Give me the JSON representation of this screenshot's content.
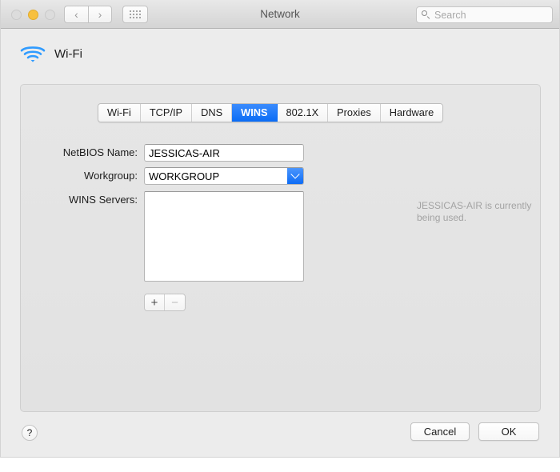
{
  "window": {
    "title": "Network",
    "traffic_lights": [
      {
        "name": "close",
        "color": "#dcdcdc",
        "active": false
      },
      {
        "name": "minimize",
        "color": "#f7c03e",
        "active": true
      },
      {
        "name": "zoom",
        "color": "#dcdcdc",
        "active": false
      }
    ],
    "nav": {
      "back": "‹",
      "forward": "›",
      "grid_icon": "grid-icon"
    },
    "search": {
      "placeholder": "Search",
      "value": "",
      "icon": "search-icon"
    }
  },
  "service": {
    "name": "Wi-Fi",
    "icon": "wifi-icon",
    "icon_color": "#1a8cff"
  },
  "tabs": [
    {
      "label": "Wi-Fi",
      "selected": false
    },
    {
      "label": "TCP/IP",
      "selected": false
    },
    {
      "label": "DNS",
      "selected": false
    },
    {
      "label": "WINS",
      "selected": true
    },
    {
      "label": "802.1X",
      "selected": false
    },
    {
      "label": "Proxies",
      "selected": false
    },
    {
      "label": "Hardware",
      "selected": false
    }
  ],
  "selected_tab_color": "#0a6cf5",
  "form": {
    "netbios": {
      "label": "NetBIOS Name:",
      "value": "JESSICAS-AIR"
    },
    "workgroup": {
      "label": "Workgroup:",
      "value": "WORKGROUP",
      "arrow_icon": "chevron-down-icon"
    },
    "wins_servers": {
      "label": "WINS Servers:",
      "items": []
    },
    "hint": "JESSICAS-AIR is currently being used.",
    "add_button": "+",
    "remove_button": "−"
  },
  "footer": {
    "help": "?",
    "cancel": "Cancel",
    "ok": "OK"
  }
}
